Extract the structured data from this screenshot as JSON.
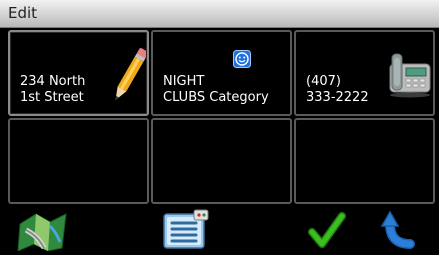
{
  "header": {
    "title": "Edit"
  },
  "tiles": [
    {
      "line1": "234 North",
      "line2": "1st Street",
      "icon": "pencil-icon"
    },
    {
      "line1": "NIGHT",
      "line2": "CLUBS Category",
      "icon": "smiley-category-icon"
    },
    {
      "line1": "(407)",
      "line2": "333-2222",
      "icon": "telephone-icon"
    },
    {
      "line1": "",
      "line2": ""
    },
    {
      "line1": "",
      "line2": ""
    },
    {
      "line1": "",
      "line2": ""
    }
  ],
  "bottom_bar": {
    "buttons": [
      {
        "icon": "map-icon"
      },
      {
        "icon": "list-menu-icon"
      },
      {
        "icon": "checkmark-icon"
      },
      {
        "icon": "back-arrow-icon"
      }
    ]
  },
  "colors": {
    "header_bg": "#d9d9d9",
    "tile_border": "#5a5a5a",
    "check_green": "#3bbf1d",
    "back_blue": "#2c7fd8"
  }
}
